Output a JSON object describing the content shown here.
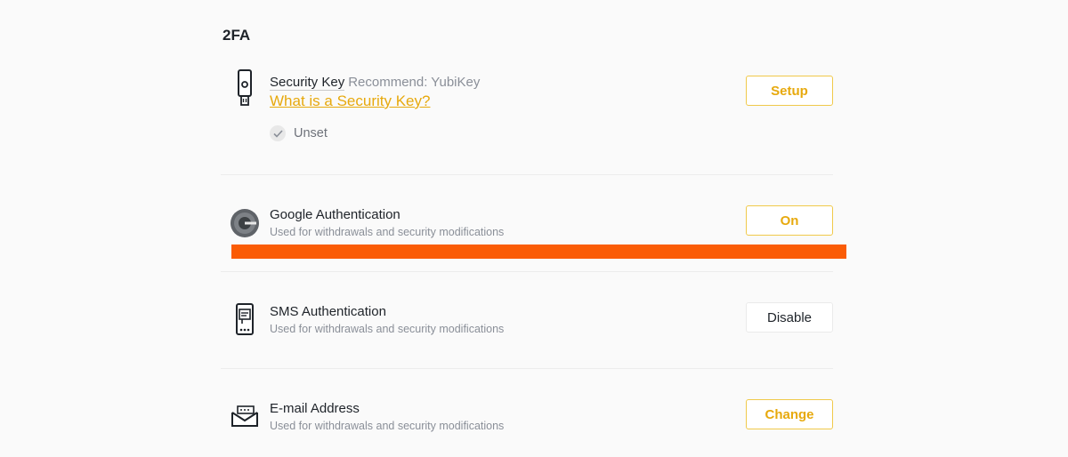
{
  "section": {
    "title": "2FA"
  },
  "security_key": {
    "title": "Security Key",
    "recommend": "Recommend: YubiKey",
    "link": "What is a Security Key?",
    "status": "Unset",
    "button": "Setup",
    "icon": "usb-security-key-icon"
  },
  "google_auth": {
    "title": "Google Authentication",
    "description": "Used for withdrawals and security modifications",
    "button": "On",
    "icon": "google-authenticator-icon"
  },
  "sms_auth": {
    "title": "SMS Authentication",
    "description": "Used for withdrawals and security modifications",
    "button": "Disable",
    "icon": "phone-sms-icon"
  },
  "email": {
    "title": "E-mail Address",
    "description": "Used for withdrawals and security modifications",
    "button": "Change",
    "icon": "envelope-icon"
  },
  "colors": {
    "accent": "#e7a90d",
    "button_border": "#f0c94a",
    "highlight_bar": "#fa5c05",
    "text_primary": "#1e2329",
    "text_secondary": "#8a8f98"
  }
}
